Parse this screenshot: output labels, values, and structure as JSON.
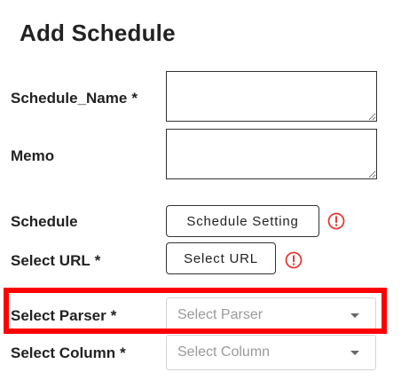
{
  "form": {
    "title": "Add Schedule",
    "required_mark": "*",
    "fields": {
      "schedule_name": {
        "label": "Schedule_Name",
        "value": ""
      },
      "memo": {
        "label": "Memo",
        "value": ""
      },
      "schedule": {
        "label": "Schedule",
        "button_label": "Schedule Setting"
      },
      "select_url": {
        "label": "Select URL",
        "button_label": "Select URL"
      },
      "select_parser": {
        "label": "Select Parser",
        "placeholder": "Select Parser"
      },
      "select_column": {
        "label": "Select Column",
        "placeholder": "Select Column"
      }
    }
  },
  "icons": {
    "warning": "exclamation-circle-icon",
    "dropdown": "caret-down-icon"
  },
  "colors": {
    "warning": "#e53935",
    "highlight": "#ff0000",
    "placeholder": "#9a9a9a",
    "select_border": "#d4d4d4"
  }
}
